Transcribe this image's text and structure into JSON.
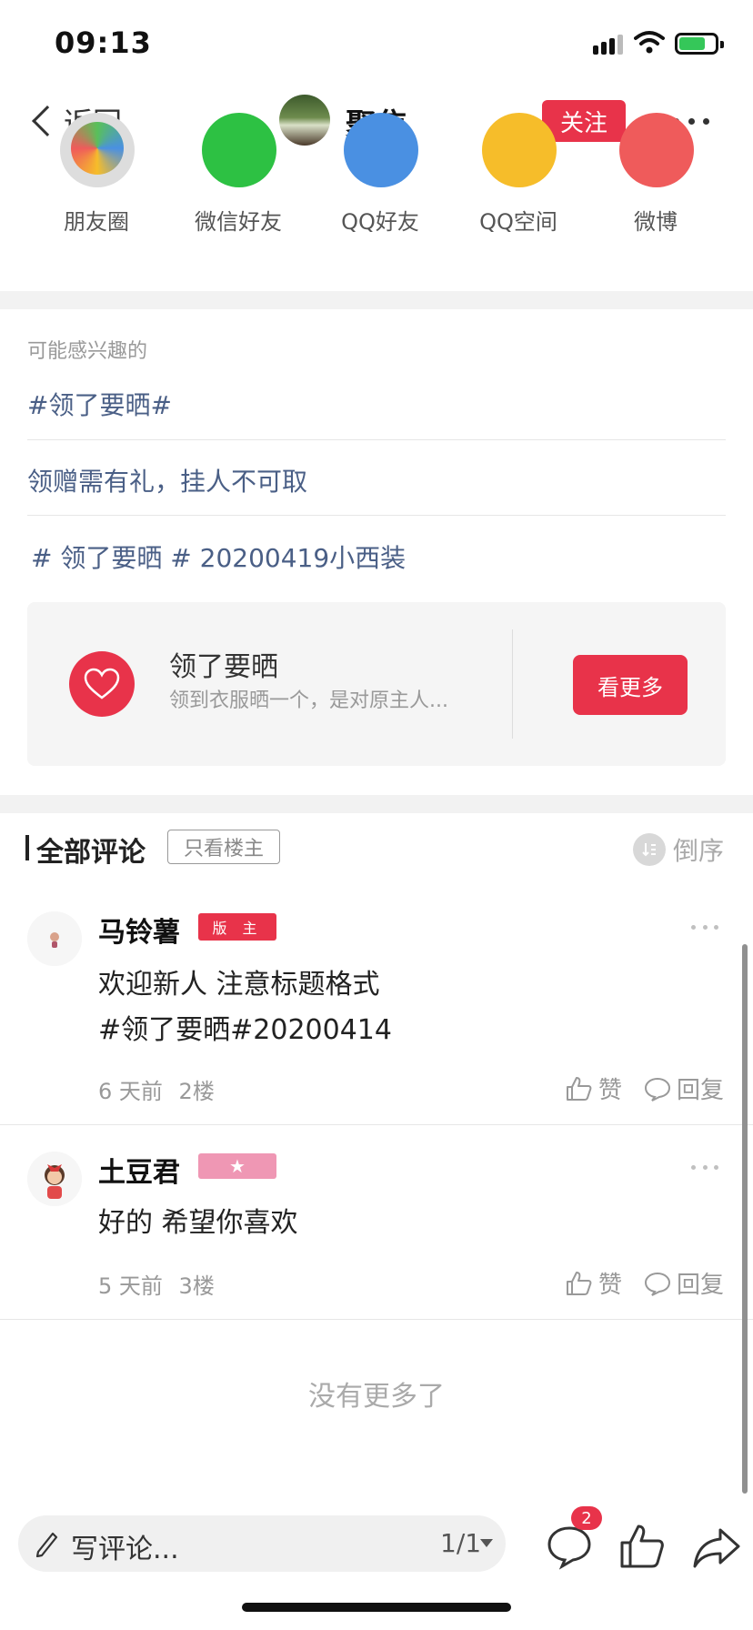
{
  "status": {
    "time": "09:13"
  },
  "nav": {
    "back_label": "返回",
    "title": "聚焦",
    "follow_label": "关注"
  },
  "share": [
    {
      "label": "朋友圈",
      "color": "#59c05a"
    },
    {
      "label": "微信好友",
      "color": "#2dc143"
    },
    {
      "label": "QQ好友",
      "color": "#4a90e2"
    },
    {
      "label": "QQ空间",
      "color": "#f6bd2a"
    },
    {
      "label": "微博",
      "color": "#ef5b5b"
    }
  ],
  "interest": {
    "title": "可能感兴趣的",
    "topics": [
      "#领了要晒#",
      "领赠需有礼，挂人不可取",
      "# 领了要晒 # 20200419小西装"
    ],
    "card": {
      "title": "领了要晒",
      "desc": "领到衣服晒一个，是对原主人...",
      "button": "看更多"
    }
  },
  "comments_header": {
    "title": "全部评论",
    "only_op": "只看楼主",
    "sort": "倒序"
  },
  "comments": [
    {
      "name": "马铃薯",
      "badge": "版 主",
      "lines": [
        "欢迎新人 注意标题格式",
        "#领了要晒#20200414"
      ],
      "time": "6 天前",
      "floor": "2楼",
      "like": "赞",
      "reply": "回复"
    },
    {
      "name": "土豆君",
      "badge": "★",
      "lines": [
        "好的 希望你喜欢"
      ],
      "time": "5 天前",
      "floor": "3楼",
      "like": "赞",
      "reply": "回复"
    }
  ],
  "no_more": "没有更多了",
  "bottom": {
    "placeholder": "写评论...",
    "page": "1/1",
    "notif_count": "2"
  },
  "colors": {
    "accent": "#e8334a",
    "link": "#4a5f86"
  }
}
